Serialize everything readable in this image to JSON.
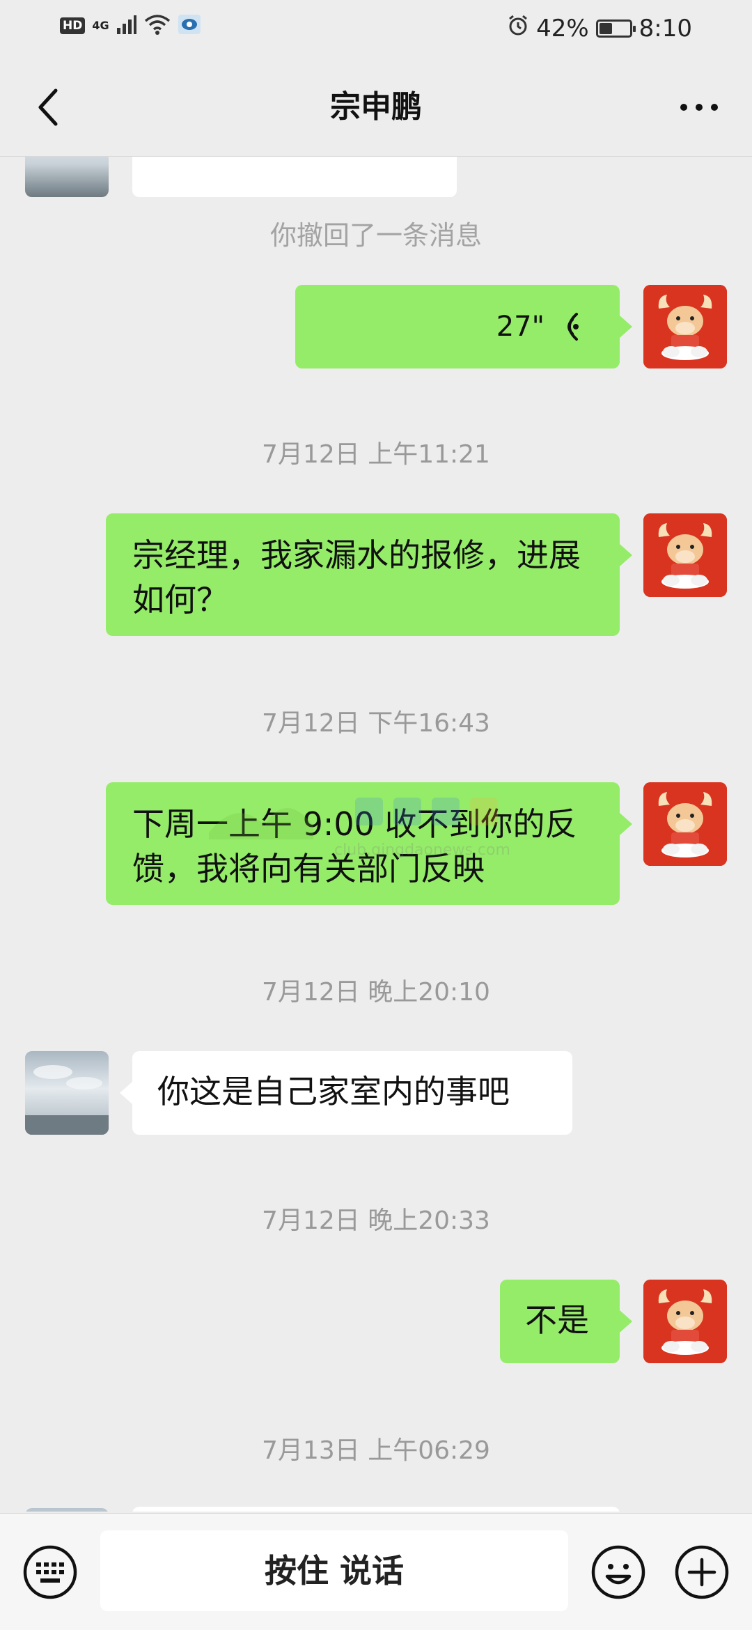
{
  "status_bar": {
    "hd": "HD",
    "network": "4G",
    "battery_percent": "42%",
    "battery_level": 0.42,
    "time": "8:10"
  },
  "nav": {
    "title": "宗申鹏",
    "back_icon": "chevron-left-icon",
    "more_icon": "more-dots-icon"
  },
  "chat": {
    "system_note": "你撤回了一条消息",
    "voice_message": {
      "duration": "27\"",
      "icon": "voice-wave-icon"
    },
    "timestamps": [
      "7月12日 上午11:21",
      "7月12日 下午16:43",
      "7月12日 晚上20:10",
      "7月12日 晚上20:33",
      "7月13日 上午06:29"
    ],
    "messages": [
      {
        "side": "out",
        "text": "宗经理，我家漏水的报修，进展如何？"
      },
      {
        "side": "out",
        "text": "下周一上午 9:00 收不到你的反馈，我将向有关部门反映"
      },
      {
        "side": "in",
        "text": "你这是自己家室内的事吧"
      },
      {
        "side": "out",
        "text": "不是"
      }
    ],
    "watermark": "club.qingdaonews.com"
  },
  "input_bar": {
    "keyboard_icon": "keyboard-icon",
    "hold_to_talk": "按住 说话",
    "emoji_icon": "emoji-icon",
    "plus_icon": "plus-icon"
  },
  "colors": {
    "outgoing_bubble": "#95ec69",
    "incoming_bubble": "#ffffff",
    "background": "#ededed",
    "avatar_red": "#d9341f"
  }
}
